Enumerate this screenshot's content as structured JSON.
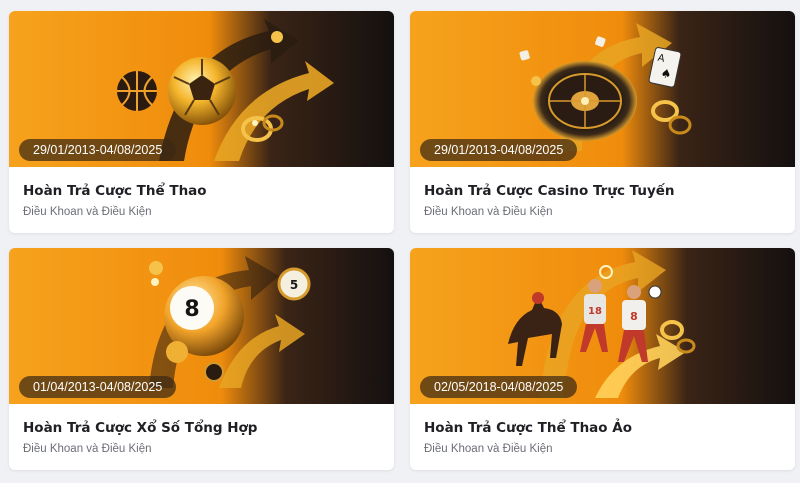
{
  "colors": {
    "page_background": "#f0f1f4",
    "banner_orange": "#f39a12",
    "banner_dark": "#1b1512",
    "gold": "#ffc53a",
    "title_text": "#1f1f24",
    "subtitle_text": "#6b6e76"
  },
  "promotions": [
    {
      "date_range": "29/01/2013-04/08/2025",
      "title": "Hoàn Trả Cược Thể Thao",
      "terms_link": "Điều Khoan và Điều Kiện",
      "illustration": "soccer-ball-basketball-icon"
    },
    {
      "date_range": "29/01/2013-04/08/2025",
      "title": "Hoàn Trả Cược Casino Trực Tuyến",
      "terms_link": "Điều Khoan và Điều Kiện",
      "illustration": "roulette-cards-icon"
    },
    {
      "date_range": "01/04/2013-04/08/2025",
      "title": "Hoàn Trả Cược Xổ Số Tổng Hợp",
      "terms_link": "Điều Khoan và Điều Kiện",
      "illustration": "lottery-ball-icon",
      "ball_numbers": [
        "8",
        "5"
      ]
    },
    {
      "date_range": "02/05/2018-04/08/2025",
      "title": "Hoàn Trả Cược Thể Thao Ảo",
      "terms_link": "Điều Khoan và Điều Kiện",
      "illustration": "virtual-sports-players-icon",
      "jersey_numbers": [
        "18",
        "8"
      ]
    }
  ]
}
